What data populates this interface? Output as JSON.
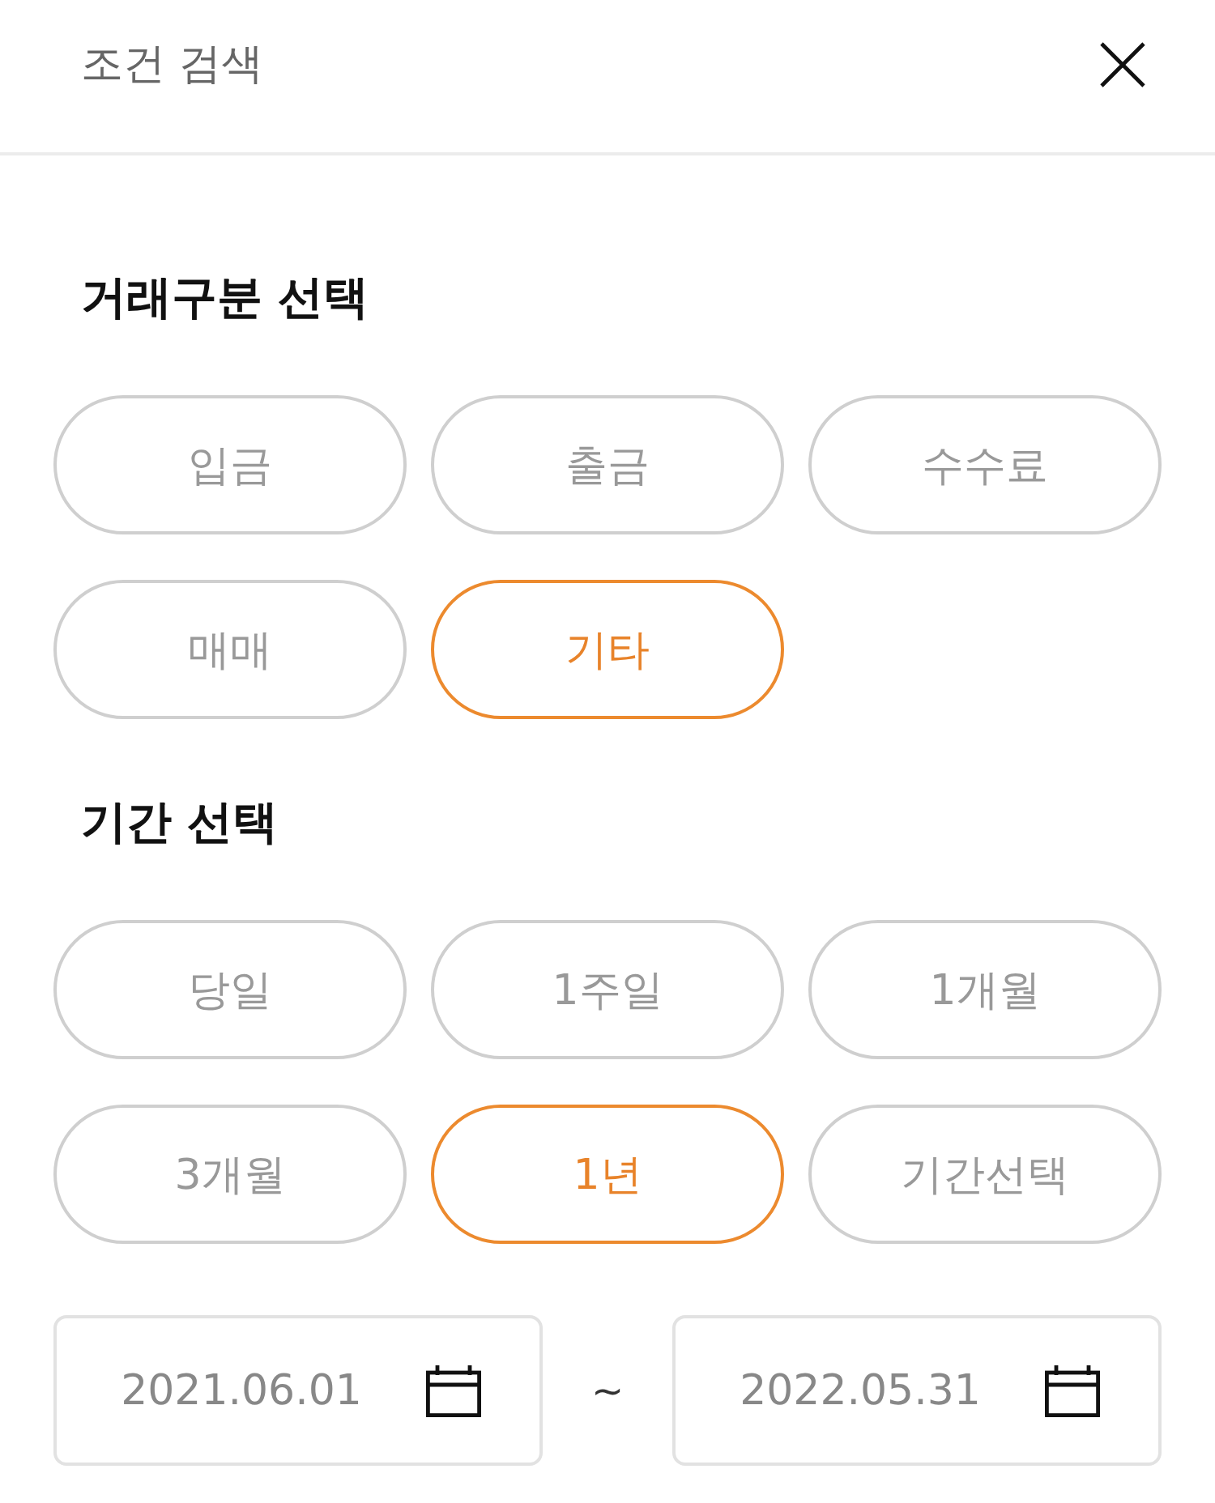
{
  "header": {
    "title": "조건 검색"
  },
  "sections": [
    {
      "title": "거래구분 선택",
      "options": [
        {
          "label": "입금",
          "selected": false
        },
        {
          "label": "출금",
          "selected": false
        },
        {
          "label": "수수료",
          "selected": false
        },
        {
          "label": "매매",
          "selected": false
        },
        {
          "label": "기타",
          "selected": true
        }
      ]
    },
    {
      "title": "기간 선택",
      "options": [
        {
          "label": "당일",
          "selected": false
        },
        {
          "label": "1주일",
          "selected": false
        },
        {
          "label": "1개월",
          "selected": false
        },
        {
          "label": "3개월",
          "selected": false
        },
        {
          "label": "1년",
          "selected": true
        },
        {
          "label": "기간선택",
          "selected": false
        }
      ]
    }
  ],
  "date_range": {
    "start": "2021.06.01",
    "separator": "~",
    "end": "2022.05.31"
  }
}
